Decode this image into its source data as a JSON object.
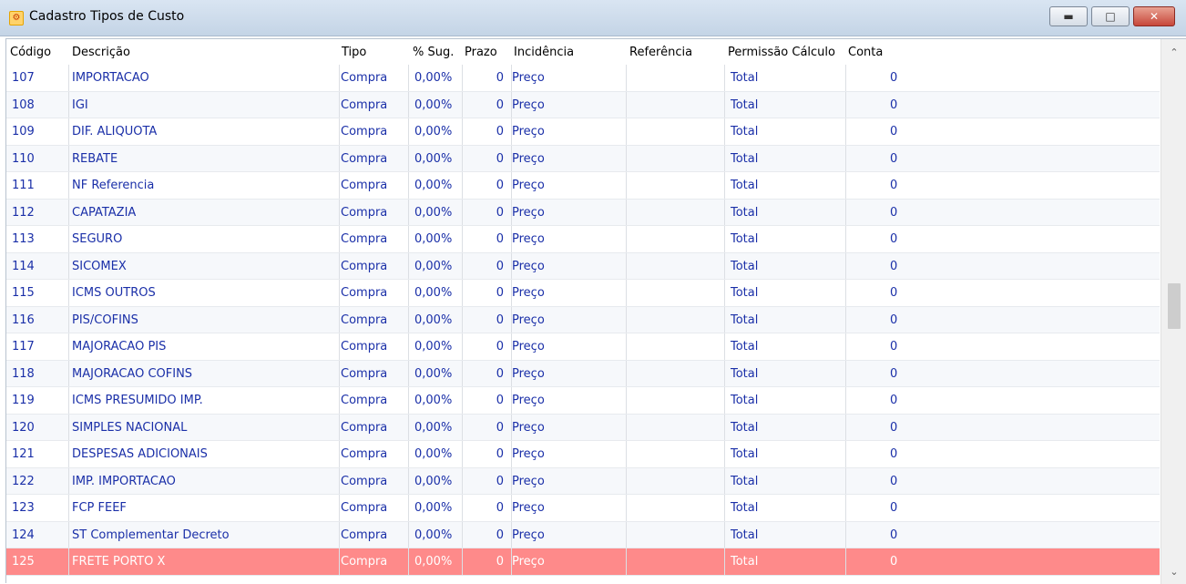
{
  "window": {
    "title": "Cadastro Tipos de Custo",
    "icon": "app-icon",
    "buttons": {
      "minimize": "▬",
      "maximize": "□",
      "close": "✕"
    }
  },
  "table": {
    "headers": {
      "codigo": "Código",
      "descricao": "Descrição",
      "tipo": "Tipo",
      "sug": "% Sug.",
      "prazo": "Prazo",
      "incidencia": "Incidência",
      "referencia": "Referência",
      "permissao": "Permissão Cálculo",
      "conta": "Conta"
    },
    "rows": [
      {
        "codigo": "107",
        "descricao": "IMPORTACAO",
        "tipo": "Compra",
        "sug": "0,00%",
        "prazo": "0",
        "incidencia": "Preço",
        "referencia": "",
        "permissao": "Total",
        "conta": "0"
      },
      {
        "codigo": "108",
        "descricao": "IGI",
        "tipo": "Compra",
        "sug": "0,00%",
        "prazo": "0",
        "incidencia": "Preço",
        "referencia": "",
        "permissao": "Total",
        "conta": "0"
      },
      {
        "codigo": "109",
        "descricao": "DIF. ALIQUOTA",
        "tipo": "Compra",
        "sug": "0,00%",
        "prazo": "0",
        "incidencia": "Preço",
        "referencia": "",
        "permissao": "Total",
        "conta": "0"
      },
      {
        "codigo": "110",
        "descricao": "REBATE",
        "tipo": "Compra",
        "sug": "0,00%",
        "prazo": "0",
        "incidencia": "Preço",
        "referencia": "",
        "permissao": "Total",
        "conta": "0"
      },
      {
        "codigo": "111",
        "descricao": "NF Referencia",
        "tipo": "Compra",
        "sug": "0,00%",
        "prazo": "0",
        "incidencia": "Preço",
        "referencia": "",
        "permissao": "Total",
        "conta": "0"
      },
      {
        "codigo": "112",
        "descricao": "CAPATAZIA",
        "tipo": "Compra",
        "sug": "0,00%",
        "prazo": "0",
        "incidencia": "Preço",
        "referencia": "",
        "permissao": "Total",
        "conta": "0"
      },
      {
        "codigo": "113",
        "descricao": "SEGURO",
        "tipo": "Compra",
        "sug": "0,00%",
        "prazo": "0",
        "incidencia": "Preço",
        "referencia": "",
        "permissao": "Total",
        "conta": "0"
      },
      {
        "codigo": "114",
        "descricao": "SICOMEX",
        "tipo": "Compra",
        "sug": "0,00%",
        "prazo": "0",
        "incidencia": "Preço",
        "referencia": "",
        "permissao": "Total",
        "conta": "0"
      },
      {
        "codigo": "115",
        "descricao": "ICMS OUTROS",
        "tipo": "Compra",
        "sug": "0,00%",
        "prazo": "0",
        "incidencia": "Preço",
        "referencia": "",
        "permissao": "Total",
        "conta": "0"
      },
      {
        "codigo": "116",
        "descricao": "PIS/COFINS",
        "tipo": "Compra",
        "sug": "0,00%",
        "prazo": "0",
        "incidencia": "Preço",
        "referencia": "",
        "permissao": "Total",
        "conta": "0"
      },
      {
        "codigo": "117",
        "descricao": "MAJORACAO PIS",
        "tipo": "Compra",
        "sug": "0,00%",
        "prazo": "0",
        "incidencia": "Preço",
        "referencia": "",
        "permissao": "Total",
        "conta": "0"
      },
      {
        "codigo": "118",
        "descricao": "MAJORACAO COFINS",
        "tipo": "Compra",
        "sug": "0,00%",
        "prazo": "0",
        "incidencia": "Preço",
        "referencia": "",
        "permissao": "Total",
        "conta": "0"
      },
      {
        "codigo": "119",
        "descricao": "ICMS PRESUMIDO IMP.",
        "tipo": "Compra",
        "sug": "0,00%",
        "prazo": "0",
        "incidencia": "Preço",
        "referencia": "",
        "permissao": "Total",
        "conta": "0"
      },
      {
        "codigo": "120",
        "descricao": "SIMPLES NACIONAL",
        "tipo": "Compra",
        "sug": "0,00%",
        "prazo": "0",
        "incidencia": "Preço",
        "referencia": "",
        "permissao": "Total",
        "conta": "0"
      },
      {
        "codigo": "121",
        "descricao": "DESPESAS ADICIONAIS",
        "tipo": "Compra",
        "sug": "0,00%",
        "prazo": "0",
        "incidencia": "Preço",
        "referencia": "",
        "permissao": "Total",
        "conta": "0"
      },
      {
        "codigo": "122",
        "descricao": "IMP. IMPORTACAO",
        "tipo": "Compra",
        "sug": "0,00%",
        "prazo": "0",
        "incidencia": "Preço",
        "referencia": "",
        "permissao": "Total",
        "conta": "0"
      },
      {
        "codigo": "123",
        "descricao": "FCP FEEF",
        "tipo": "Compra",
        "sug": "0,00%",
        "prazo": "0",
        "incidencia": "Preço",
        "referencia": "",
        "permissao": "Total",
        "conta": "0"
      },
      {
        "codigo": "124",
        "descricao": "ST Complementar Decreto",
        "tipo": "Compra",
        "sug": "0,00%",
        "prazo": "0",
        "incidencia": "Preço",
        "referencia": "",
        "permissao": "Total",
        "conta": "0"
      },
      {
        "codigo": "125",
        "descricao": "FRETE PORTO X",
        "tipo": "Compra",
        "sug": "0,00%",
        "prazo": "0",
        "incidencia": "Preço",
        "referencia": "",
        "permissao": "Total",
        "conta": "0",
        "selected": true
      }
    ]
  },
  "scrollbar": {
    "up": "⌃",
    "down": "⌄",
    "position": 0.5
  },
  "colors": {
    "row_text": "#1a2fa8",
    "selected_row": "#fe8a8a"
  }
}
